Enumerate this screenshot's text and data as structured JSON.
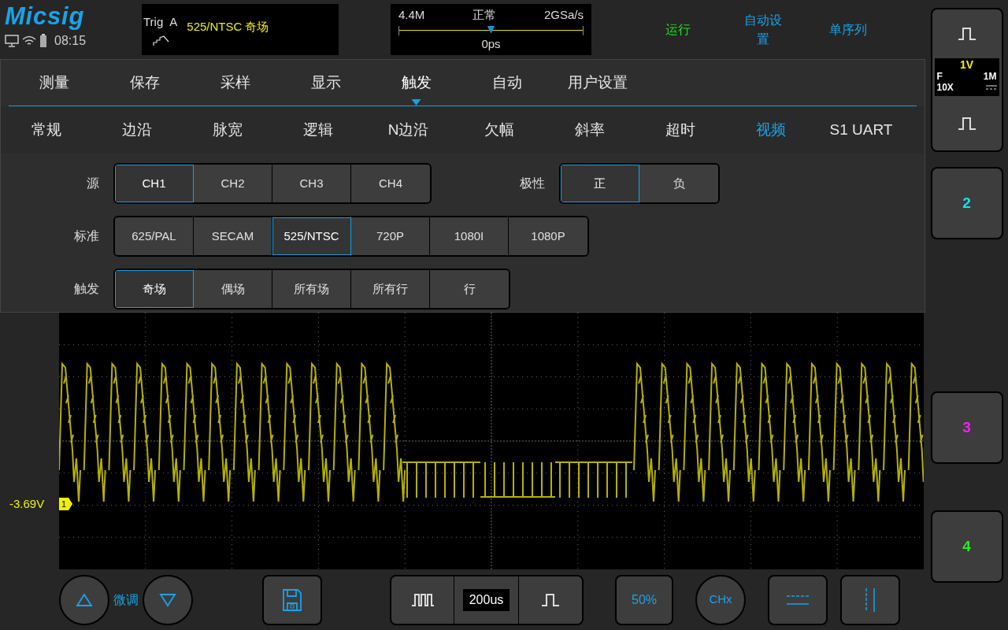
{
  "header": {
    "logo": "Micsig",
    "time": "08:15"
  },
  "trigger_info": {
    "label": "Trig",
    "source": "A",
    "setting": "525/NTSC 奇场"
  },
  "timebase_info": {
    "memory": "4.4M",
    "mode": "正常",
    "sample_rate": "2GSa/s",
    "offset": "0ps",
    "level": 0.5
  },
  "top_buttons": [
    {
      "label": "运行",
      "color": "#22dd22"
    },
    {
      "label": "自动设置",
      "color": "#1aa3e8"
    },
    {
      "label": "单序列",
      "color": "#1aa3e8"
    }
  ],
  "menu_tabs": [
    {
      "label": "测量",
      "selected": false
    },
    {
      "label": "保存",
      "selected": false
    },
    {
      "label": "采样",
      "selected": false
    },
    {
      "label": "显示",
      "selected": false
    },
    {
      "label": "触发",
      "selected": true
    },
    {
      "label": "自动",
      "selected": false
    },
    {
      "label": "用户设置",
      "selected": false
    }
  ],
  "sub_tabs": [
    {
      "label": "常规",
      "selected": false
    },
    {
      "label": "边沿",
      "selected": false
    },
    {
      "label": "脉宽",
      "selected": false
    },
    {
      "label": "逻辑",
      "selected": false
    },
    {
      "label": "N边沿",
      "selected": false
    },
    {
      "label": "欠幅",
      "selected": false
    },
    {
      "label": "斜率",
      "selected": false
    },
    {
      "label": "超时",
      "selected": false
    },
    {
      "label": "视频",
      "selected": true
    },
    {
      "label": "S1 UART",
      "selected": false
    }
  ],
  "setting_rows": [
    {
      "groups": [
        {
          "label": "源",
          "options": [
            {
              "label": "CH1",
              "selected": true
            },
            {
              "label": "CH2",
              "selected": false
            },
            {
              "label": "CH3",
              "selected": false
            },
            {
              "label": "CH4",
              "selected": false
            }
          ]
        },
        {
          "label": "极性",
          "options": [
            {
              "label": "正",
              "selected": true
            },
            {
              "label": "负",
              "selected": false
            }
          ]
        }
      ]
    },
    {
      "groups": [
        {
          "label": "标准",
          "options": [
            {
              "label": "625/PAL",
              "selected": false
            },
            {
              "label": "SECAM",
              "selected": false
            },
            {
              "label": "525/NTSC",
              "selected": true
            },
            {
              "label": "720P",
              "selected": false
            },
            {
              "label": "1080I",
              "selected": false
            },
            {
              "label": "1080P",
              "selected": false
            }
          ]
        }
      ]
    },
    {
      "groups": [
        {
          "label": "触发",
          "options": [
            {
              "label": "奇场",
              "selected": true
            },
            {
              "label": "偶场",
              "selected": false
            },
            {
              "label": "所有场",
              "selected": false
            },
            {
              "label": "所有行",
              "selected": false
            },
            {
              "label": "行",
              "selected": false
            }
          ]
        }
      ]
    }
  ],
  "channel_1": {
    "scale": "1V",
    "bandwidth": "F",
    "impedance": "1M",
    "probe": "10X"
  },
  "channels": [
    {
      "label": "2",
      "color": "#19e0e8"
    },
    {
      "label": "3",
      "color": "#ff1aff"
    },
    {
      "label": "4",
      "color": "#22ee22"
    }
  ],
  "scope": {
    "offset_reading": "-3.69V",
    "marker": "1"
  },
  "bottom_bar": {
    "fine_label": "微调",
    "timebase": "200us",
    "trigger_50": "50%",
    "channel_select": "CHx"
  }
}
